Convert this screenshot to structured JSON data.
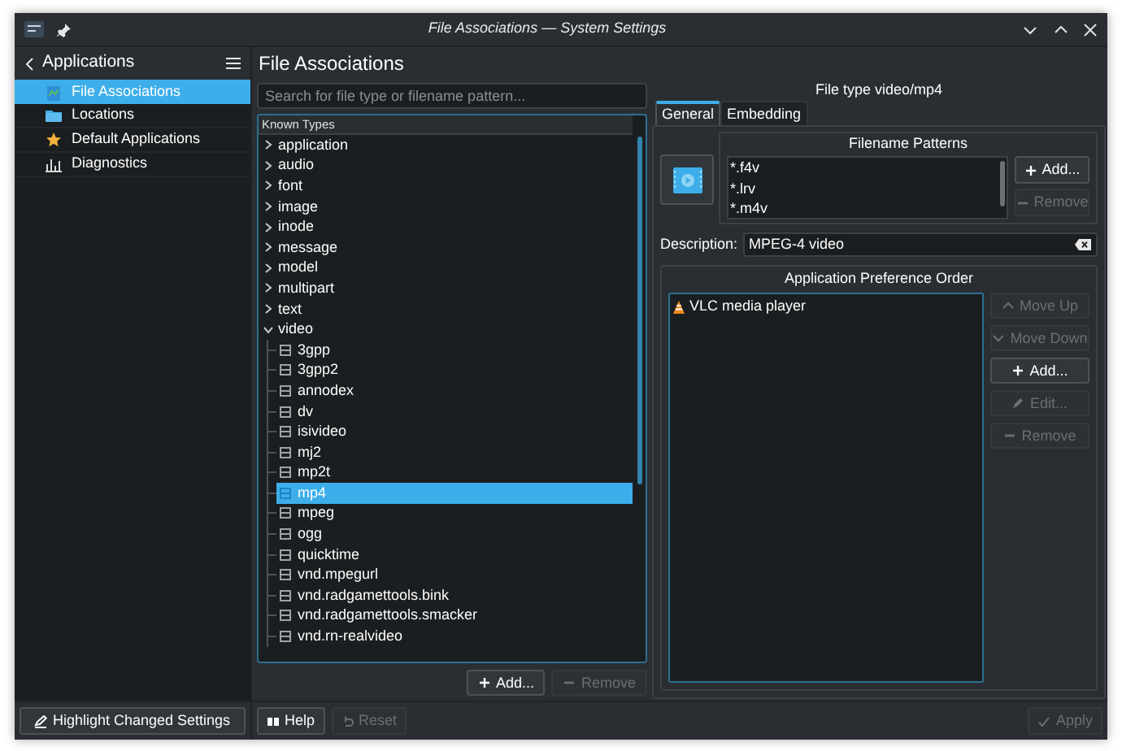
{
  "window": {
    "title": "File Associations — System Settings"
  },
  "sidebar": {
    "back_label": "Applications",
    "items": [
      {
        "label": "File Associations",
        "selected": true
      },
      {
        "label": "Locations",
        "selected": false
      },
      {
        "label": "Default Applications",
        "selected": false
      },
      {
        "label": "Diagnostics",
        "selected": false
      }
    ],
    "highlight_button": "Highlight Changed Settings"
  },
  "page_title": "File Associations",
  "search": {
    "placeholder": "Search for file type or filename pattern..."
  },
  "tree": {
    "header": "Known Types",
    "items": [
      {
        "label": "application",
        "expanded": false
      },
      {
        "label": "audio",
        "expanded": false
      },
      {
        "label": "font",
        "expanded": false
      },
      {
        "label": "image",
        "expanded": false
      },
      {
        "label": "inode",
        "expanded": false
      },
      {
        "label": "message",
        "expanded": false
      },
      {
        "label": "model",
        "expanded": false
      },
      {
        "label": "multipart",
        "expanded": false
      },
      {
        "label": "text",
        "expanded": false
      },
      {
        "label": "video",
        "expanded": true,
        "children": [
          {
            "label": "3gpp",
            "selected": false
          },
          {
            "label": "3gpp2",
            "selected": false
          },
          {
            "label": "annodex",
            "selected": false
          },
          {
            "label": "dv",
            "selected": false
          },
          {
            "label": "isivideo",
            "selected": false
          },
          {
            "label": "mj2",
            "selected": false
          },
          {
            "label": "mp2t",
            "selected": false
          },
          {
            "label": "mp4",
            "selected": true
          },
          {
            "label": "mpeg",
            "selected": false
          },
          {
            "label": "ogg",
            "selected": false
          },
          {
            "label": "quicktime",
            "selected": false
          },
          {
            "label": "vnd.mpegurl",
            "selected": false
          },
          {
            "label": "vnd.radgamettools.bink",
            "selected": false
          },
          {
            "label": "vnd.radgamettools.smacker",
            "selected": false
          },
          {
            "label": "vnd.rn-realvideo",
            "selected": false
          }
        ]
      }
    ]
  },
  "tree_buttons": [
    {
      "label": "Add...",
      "disabled": false
    },
    {
      "label": "Remove",
      "disabled": true
    }
  ],
  "details": {
    "heading": "File type video/mp4",
    "tabs": [
      {
        "label": "General",
        "selected": true
      },
      {
        "label": "Embedding",
        "selected": false
      }
    ],
    "filename_patterns": {
      "title": "Filename Patterns",
      "patterns": [
        "*.f4v",
        "*.lrv",
        "*.m4v"
      ],
      "buttons": [
        {
          "label": "Add...",
          "disabled": false
        },
        {
          "label": "Remove",
          "disabled": true
        }
      ]
    },
    "description": {
      "label": "Description:",
      "value": "MPEG-4 video"
    },
    "app_order": {
      "title": "Application Preference Order",
      "apps": [
        "VLC media player"
      ],
      "buttons": [
        {
          "label": "Move Up",
          "disabled": true
        },
        {
          "label": "Move Down",
          "disabled": true
        },
        {
          "label": "Add...",
          "disabled": false
        },
        {
          "label": "Edit...",
          "disabled": true
        },
        {
          "label": "Remove",
          "disabled": true
        }
      ]
    }
  },
  "footer": {
    "buttons": [
      {
        "label": "Help",
        "disabled": false
      },
      {
        "label": "Reset",
        "disabled": true
      }
    ],
    "apply": {
      "label": "Apply",
      "disabled": true
    }
  }
}
